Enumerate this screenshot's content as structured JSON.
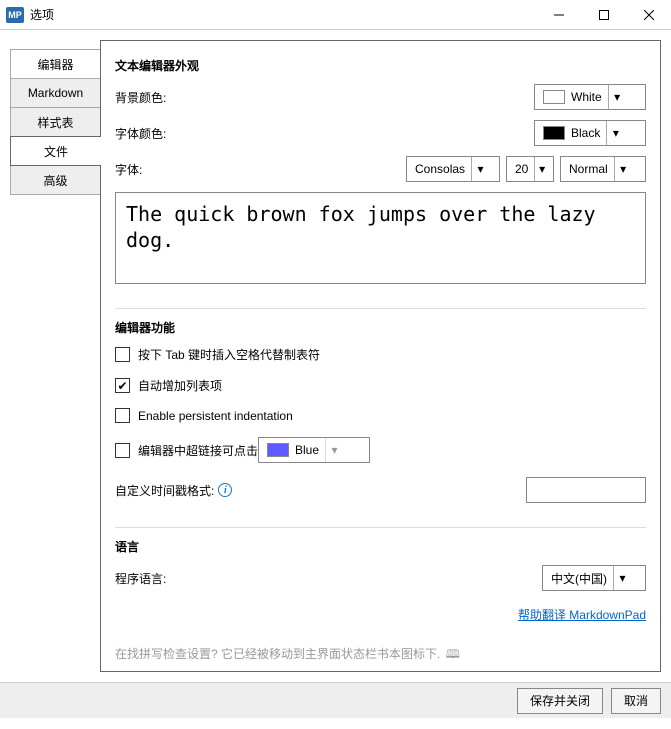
{
  "window": {
    "app_icon_text": "MP",
    "title": "选项"
  },
  "sidebar": {
    "tabs": [
      {
        "label": "编辑器",
        "active": false
      },
      {
        "label": "Markdown",
        "active": false
      },
      {
        "label": "样式表",
        "active": false
      },
      {
        "label": "文件",
        "active": true
      },
      {
        "label": "高级",
        "active": false
      }
    ]
  },
  "appearance": {
    "title": "文本编辑器外观",
    "bg_label": "背景颜色:",
    "bg_value": "White",
    "bg_swatch": "#ffffff",
    "fg_label": "字体颜色:",
    "fg_value": "Black",
    "fg_swatch": "#000000",
    "font_label": "字体:",
    "font_name": "Consolas",
    "font_size": "20",
    "font_weight": "Normal",
    "preview_text": "The quick brown fox jumps over the lazy dog."
  },
  "features": {
    "title": "编辑器功能",
    "opt_tab_spaces": {
      "label": "按下 Tab 键时插入空格代替制表符",
      "checked": false
    },
    "opt_auto_list": {
      "label": "自动增加列表项",
      "checked": true
    },
    "opt_persistent": {
      "label": "Enable persistent indentation",
      "checked": false
    },
    "opt_link_click": {
      "label": "编辑器中超链接可点击",
      "checked": false
    },
    "link_color_value": "Blue",
    "link_color_swatch": "#5b5bff",
    "timestamp_label": "自定义时间戳格式:",
    "timestamp_value": ""
  },
  "language": {
    "title": "语言",
    "label": "程序语言:",
    "value": "中文(中国)",
    "help_link": "帮助翻译 MarkdownPad"
  },
  "hint": {
    "text": "在找拼写检查设置? 它已经被移动到主界面状态栏书本图标下."
  },
  "footer": {
    "save_close": "保存并关闭",
    "cancel": "取消"
  }
}
